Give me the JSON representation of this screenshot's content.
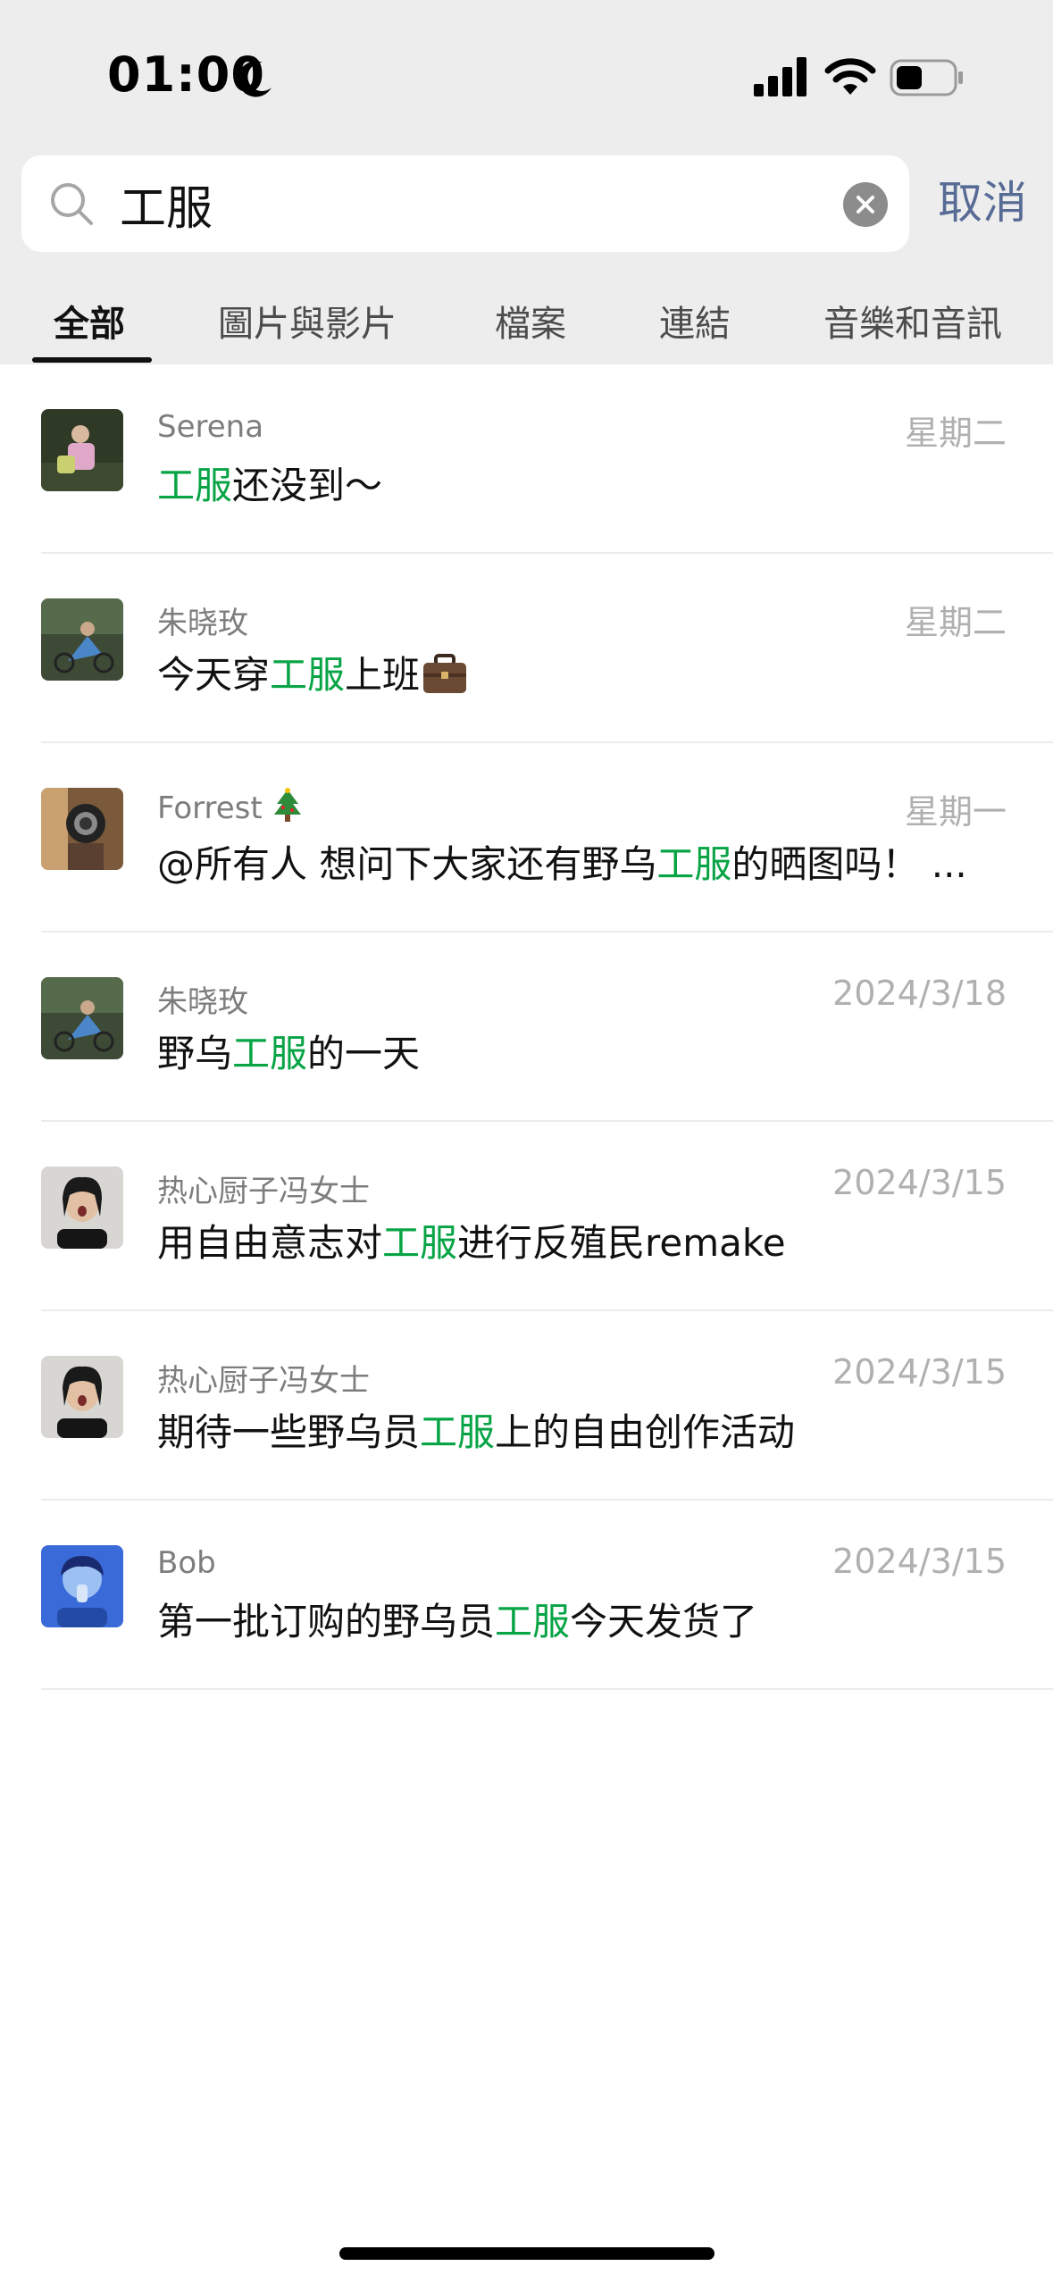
{
  "status_bar": {
    "time": "01:00"
  },
  "search": {
    "query": "工服",
    "cancel_label": "取消"
  },
  "tabs": [
    {
      "label": "全部"
    },
    {
      "label": "圖片與影片"
    },
    {
      "label": "檔案"
    },
    {
      "label": "連結"
    },
    {
      "label": "音樂和音訊"
    }
  ],
  "results": [
    {
      "sender": "Serena",
      "date": "星期二",
      "before": "",
      "highlight": "工服",
      "after": "还没到～"
    },
    {
      "sender": "朱晓玫",
      "date": "星期二",
      "before": "今天穿",
      "highlight": "工服",
      "after": "上班"
    },
    {
      "sender": "Forrest",
      "date": "星期一",
      "before": "@所有人 想问下大家还有野乌",
      "highlight": "工服",
      "after": "的晒图吗！ ..."
    },
    {
      "sender": "朱晓玫",
      "date": "2024/3/18",
      "before": "野乌",
      "highlight": "工服",
      "after": "的一天"
    },
    {
      "sender": "热心厨子冯女士",
      "date": "2024/3/15",
      "before": "用自由意志对",
      "highlight": "工服",
      "after": "进行反殖民remake"
    },
    {
      "sender": "热心厨子冯女士",
      "date": "2024/3/15",
      "before": "期待一些野乌员",
      "highlight": "工服",
      "after": "上的自由创作活动"
    },
    {
      "sender": "Bob",
      "date": "2024/3/15",
      "before": "第一批订购的野乌员",
      "highlight": "工服",
      "after": "今天发货了"
    }
  ],
  "colors": {
    "highlight": "#07a445",
    "cancel": "#576b95",
    "header_bg": "#ededed"
  }
}
